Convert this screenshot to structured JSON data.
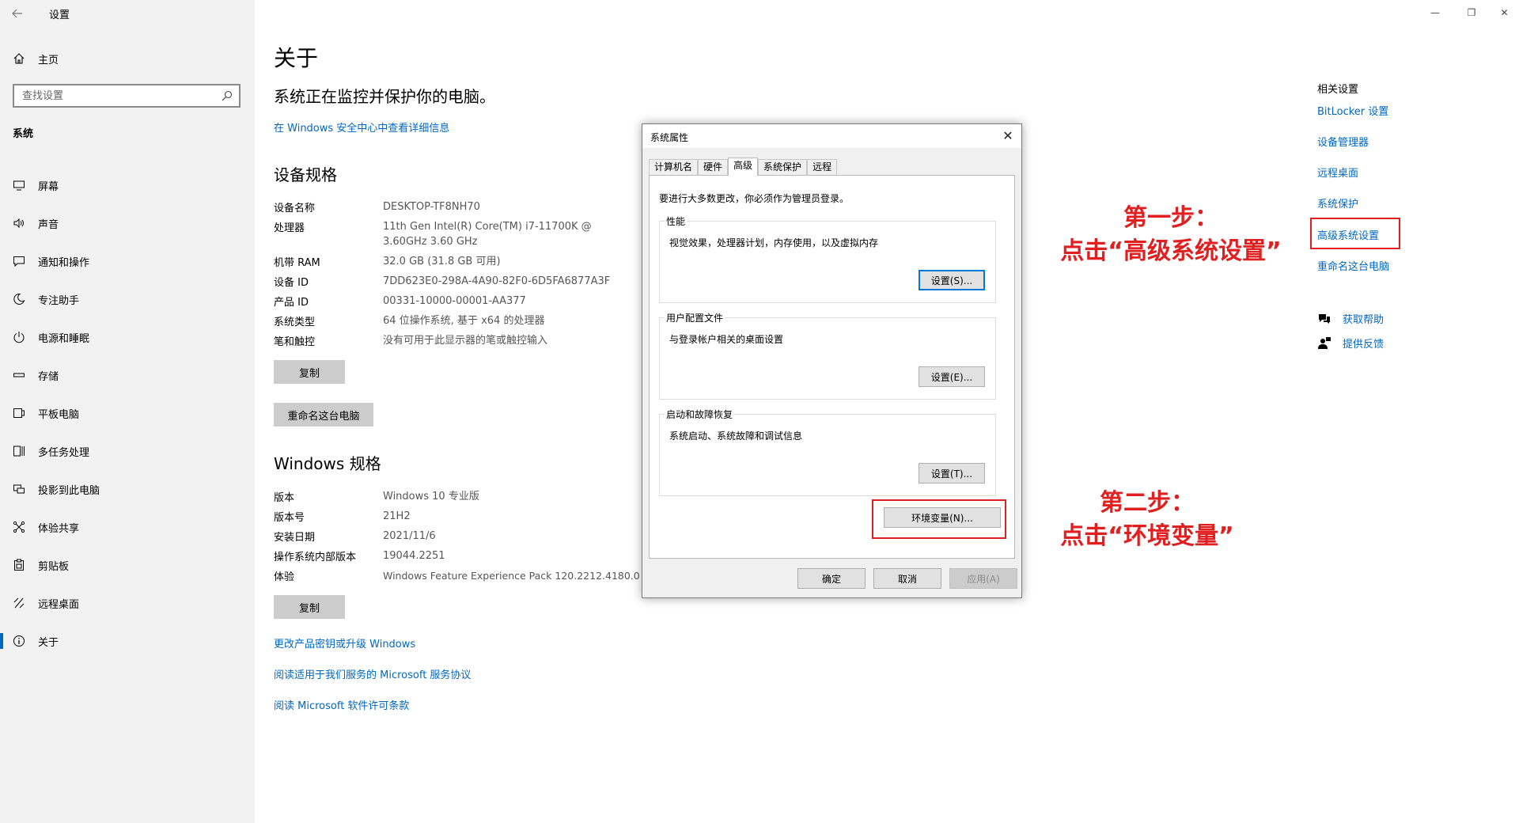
{
  "window": {
    "title": "设置",
    "minimize_glyph": "—",
    "restore_glyph": "❐",
    "close_glyph": "✕"
  },
  "sidebar": {
    "home_label": "主页",
    "search_placeholder": "查找设置",
    "section_title": "系统",
    "items": [
      {
        "label": "屏幕",
        "icon": "monitor-icon"
      },
      {
        "label": "声音",
        "icon": "speaker-icon"
      },
      {
        "label": "通知和操作",
        "icon": "notification-icon"
      },
      {
        "label": "专注助手",
        "icon": "moon-icon"
      },
      {
        "label": "电源和睡眠",
        "icon": "power-icon"
      },
      {
        "label": "存储",
        "icon": "storage-icon"
      },
      {
        "label": "平板电脑",
        "icon": "tablet-icon"
      },
      {
        "label": "多任务处理",
        "icon": "multitask-icon"
      },
      {
        "label": "投影到此电脑",
        "icon": "project-icon"
      },
      {
        "label": "体验共享",
        "icon": "share-icon"
      },
      {
        "label": "剪贴板",
        "icon": "clipboard-icon"
      },
      {
        "label": "远程桌面",
        "icon": "remote-desktop-icon"
      },
      {
        "label": "关于",
        "icon": "info-icon",
        "active": true
      }
    ]
  },
  "main": {
    "title": "关于",
    "protection_status": "系统正在监控并保护你的电脑。",
    "security_link": "在 Windows 安全中心中查看详细信息",
    "device_specs": {
      "heading": "设备规格",
      "rows": [
        {
          "key": "设备名称",
          "value": "DESKTOP-TF8NH70"
        },
        {
          "key": "处理器",
          "value": "11th Gen Intel(R) Core(TM) i7-11700K @ 3.60GHz 3.60 GHz"
        },
        {
          "key": "机带 RAM",
          "value": "32.0 GB (31.8 GB 可用)"
        },
        {
          "key": "设备 ID",
          "value": "7DD623E0-298A-4A90-82F0-6D5FA6877A3F"
        },
        {
          "key": "产品 ID",
          "value": "00331-10000-00001-AA377"
        },
        {
          "key": "系统类型",
          "value": "64 位操作系统, 基于 x64 的处理器"
        },
        {
          "key": "笔和触控",
          "value": "没有可用于此显示器的笔或触控输入"
        }
      ],
      "copy_button": "复制",
      "rename_button": "重命名这台电脑"
    },
    "windows_specs": {
      "heading": "Windows 规格",
      "rows": [
        {
          "key": "版本",
          "value": "Windows 10 专业版"
        },
        {
          "key": "版本号",
          "value": "21H2"
        },
        {
          "key": "安装日期",
          "value": "2021/11/6"
        },
        {
          "key": "操作系统内部版本",
          "value": "19044.2251"
        },
        {
          "key": "体验",
          "value": "Windows Feature Experience Pack 120.2212.4180.0"
        }
      ],
      "copy_button": "复制"
    },
    "links": [
      "更改产品密钥或升级 Windows",
      "阅读适用于我们服务的 Microsoft 服务协议",
      "阅读 Microsoft 软件许可条款"
    ]
  },
  "related": {
    "heading": "相关设置",
    "links": [
      "BitLocker 设置",
      "设备管理器",
      "远程桌面",
      "系统保护",
      "高级系统设置",
      "重命名这台电脑"
    ],
    "help_label": "获取帮助",
    "feedback_label": "提供反馈"
  },
  "dialog": {
    "title": "系统属性",
    "close_glyph": "✕",
    "tabs": [
      "计算机名",
      "硬件",
      "高级",
      "系统保护",
      "远程"
    ],
    "active_tab": "高级",
    "admin_note": "要进行大多数更改，你必须作为管理员登录。",
    "groups": [
      {
        "legend": "性能",
        "description": "视觉效果，处理器计划，内存使用，以及虚拟内存",
        "button": "设置(S)..."
      },
      {
        "legend": "用户配置文件",
        "description": "与登录帐户相关的桌面设置",
        "button": "设置(E)..."
      },
      {
        "legend": "启动和故障恢复",
        "description": "系统启动、系统故障和调试信息",
        "button": "设置(T)..."
      }
    ],
    "env_button": "环境变量(N)...",
    "ok_button": "确定",
    "cancel_button": "取消",
    "apply_button": "应用(A)"
  },
  "annotations": {
    "step1_line1": "第一步：",
    "step1_line2": "点击“高级系统设置”",
    "step2_line1": "第二步：",
    "step2_line2": "点击“环境变量”",
    "color": "#e02020"
  },
  "colors": {
    "accent": "#0067c0",
    "sidebar_bg": "#f2f2f2",
    "annotation": "#e02020"
  }
}
